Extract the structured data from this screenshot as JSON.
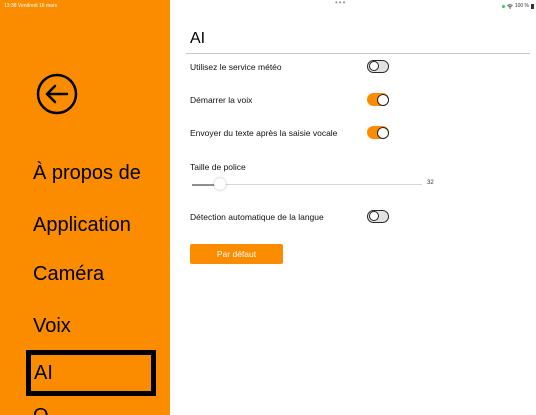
{
  "status_bar": {
    "time_date": "13:38  Vendredi 16 mars",
    "center_dots": "•••",
    "right": "100 %"
  },
  "sidebar": {
    "items": [
      {
        "label": "À propos de"
      },
      {
        "label": "Application"
      },
      {
        "label": "Caméra"
      },
      {
        "label": "Voix"
      },
      {
        "label": "AI",
        "selected": true
      }
    ],
    "partial_item_visible": "O"
  },
  "page": {
    "title": "AI"
  },
  "settings": {
    "weather_service": {
      "label": "Utilisez le service météo",
      "enabled": false
    },
    "start_voice": {
      "label": "Démarrer la voix",
      "enabled": true
    },
    "send_text_after_voice": {
      "label": "Envoyer du texte après la saisie vocale",
      "enabled": true
    },
    "font_size": {
      "label": "Taille de police",
      "value": "32",
      "slider_fraction": 0.11
    },
    "auto_language_detection": {
      "label": "Détection automatique de la langue",
      "enabled": false
    }
  },
  "buttons": {
    "default_label": "Par défaut"
  },
  "colors": {
    "accent": "#fb8c00",
    "sidebar_bg": "#fb8c00",
    "toggle_off": "#e2e2e2"
  }
}
